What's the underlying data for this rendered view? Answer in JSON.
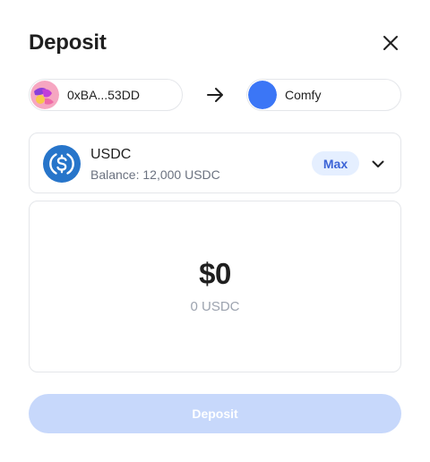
{
  "modal": {
    "title": "Deposit",
    "close_icon": "close-icon"
  },
  "from": {
    "address": "0xBA...53DD",
    "avatar_icon": "avatar-gradient",
    "avatar_colors": [
      "#f28bb0",
      "#7b3fe4",
      "#f9d34a"
    ]
  },
  "transfer_icon": "arrow-right-icon",
  "to": {
    "name": "Comfy",
    "avatar_color": "#3b76f6"
  },
  "token": {
    "symbol": "USDC",
    "balance": "Balance: 12,000 USDC",
    "icon": "usdc-icon",
    "icon_color": "#2775ca",
    "max_label": "Max",
    "chevron_icon": "chevron-down-icon"
  },
  "amount": {
    "value": "$0",
    "sub": "0 USDC"
  },
  "actions": {
    "deposit_label": "Deposit",
    "deposit_color": "#c7d8fb"
  }
}
